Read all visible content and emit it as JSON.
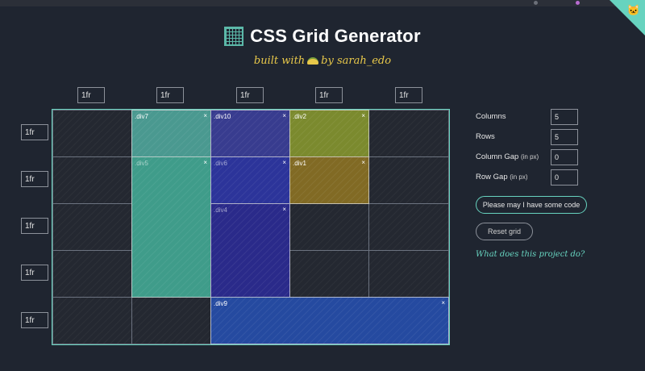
{
  "header": {
    "title": "CSS Grid Generator",
    "subtitle_prefix": "built with",
    "subtitle_suffix": "by sarah_edo"
  },
  "columns": [
    "1fr",
    "1fr",
    "1fr",
    "1fr",
    "1fr"
  ],
  "rows": [
    "1fr",
    "1fr",
    "1fr",
    "1fr",
    "1fr"
  ],
  "grid_items": [
    {
      "name": ".div7",
      "color": "#4a9990"
    },
    {
      "name": ".div10",
      "color": "#383c8f"
    },
    {
      "name": ".div2",
      "color": "#7b8a2e"
    },
    {
      "name": ".div5",
      "color": "#3f9c8a"
    },
    {
      "name": ".div6",
      "color": "#2c349a"
    },
    {
      "name": ".div1",
      "color": "#816a24"
    },
    {
      "name": ".div4",
      "color": "#2a2a8a"
    },
    {
      "name": ".div9",
      "color": "#254aa0"
    }
  ],
  "close_glyph": "×",
  "controls": {
    "columns_label": "Columns",
    "columns_value": "5",
    "rows_label": "Rows",
    "rows_value": "5",
    "column_gap_label": "Column Gap",
    "column_gap_unit": "(in px)",
    "column_gap_value": "0",
    "row_gap_label": "Row Gap",
    "row_gap_unit": "(in px)",
    "row_gap_value": "0",
    "code_button": "Please may I have some code",
    "reset_button": "Reset grid",
    "about_link": "What does this project do?"
  },
  "colors": {
    "background": "#1f2530",
    "accent": "#67d3bf",
    "subtitle": "#e8c84a"
  },
  "icons": [
    "grid-logo-icon",
    "taco-icon",
    "github-cat-icon",
    "close-icon"
  ]
}
